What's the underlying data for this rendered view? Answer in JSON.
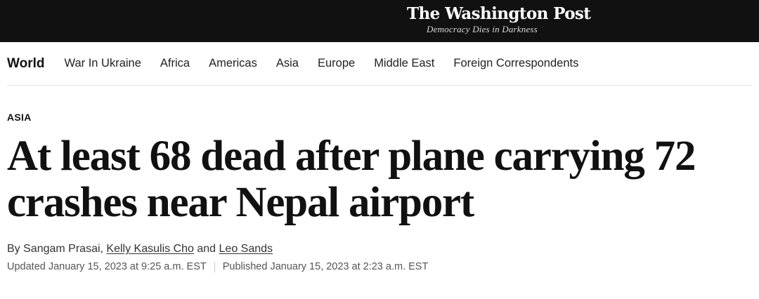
{
  "masthead": {
    "logo_text": "The Washington Post",
    "tagline": "Democracy Dies in Darkness"
  },
  "nav": {
    "home": "World",
    "items": [
      "War In Ukraine",
      "Africa",
      "Americas",
      "Asia",
      "Europe",
      "Middle East",
      "Foreign Correspondents"
    ]
  },
  "article": {
    "kicker": "ASIA",
    "headline": "At least 68 dead after plane carrying 72 crashes near Nepal airport",
    "byline": {
      "prefix": "By",
      "author_1": "Sangam Prasai",
      "separator": ",",
      "author_2": "Kelly Kasulis Cho",
      "conjunction": "and",
      "author_3": "Leo Sands"
    },
    "updated": "Updated January 15, 2023 at 9:25 a.m. EST",
    "published": "Published January 15, 2023 at 2:23 a.m. EST"
  }
}
